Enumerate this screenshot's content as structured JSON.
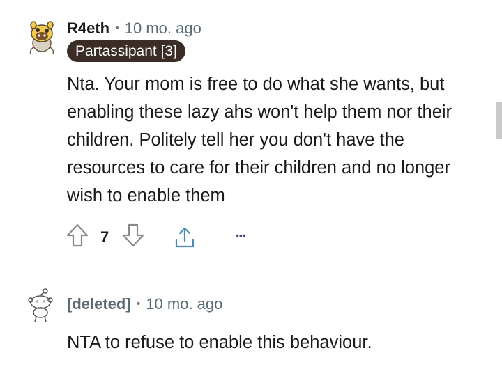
{
  "comment1": {
    "username": "R4eth",
    "separator": "•",
    "age": "10 mo. ago",
    "flair": "Partassipant [3]",
    "body": "Nta. Your mom is free to do what she wants, but enabling these lazy ahs won't help them nor their children. Politely tell her you don't have the resources to care for their children and no longer wish to enable them",
    "score": "7",
    "more_label": "•••"
  },
  "comment2": {
    "username": "[deleted]",
    "separator": "•",
    "age": "10 mo. ago",
    "body": "NTA to refuse to enable this behaviour."
  }
}
